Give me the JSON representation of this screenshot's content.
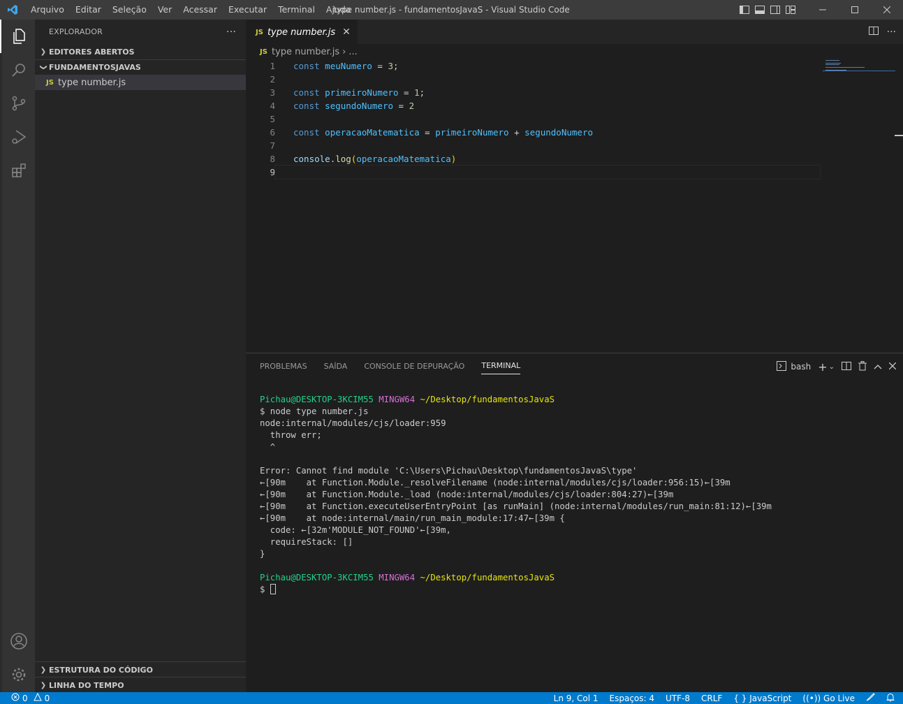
{
  "titlebar": {
    "menu": [
      "Arquivo",
      "Editar",
      "Seleção",
      "Ver",
      "Acessar",
      "Executar",
      "Terminal",
      "Ajuda"
    ],
    "title": "type number.js - fundamentosJavaS - Visual Studio Code"
  },
  "sidebar": {
    "header": "EXPLORADOR",
    "more": "···",
    "open_editors": "EDITORES ABERTOS",
    "folder": "FUNDAMENTOSJAVAS",
    "file_badge": "JS",
    "file": "type number.js",
    "outline": "ESTRUTURA DO CÓDIGO",
    "timeline": "LINHA DO TEMPO"
  },
  "editor": {
    "tab_badge": "JS",
    "tab_label": "type number.js",
    "tab_close": "✕",
    "more": "···",
    "breadcrumb_badge": "JS",
    "breadcrumb_file": "type number.js",
    "breadcrumb_sep": "›",
    "breadcrumb_more": "...",
    "lines": {
      "l1": {
        "n": "1",
        "kw": "const",
        "name": "meuNumero",
        "eq": " = ",
        "val": "3",
        "end": ";"
      },
      "l2": {
        "n": "2"
      },
      "l3": {
        "n": "3",
        "kw": "const",
        "name": "primeiroNumero",
        "eq": " = ",
        "val": "1",
        "end": ";"
      },
      "l4": {
        "n": "4",
        "kw": "const",
        "name": "segundoNumero",
        "eq": " = ",
        "val": "2"
      },
      "l5": {
        "n": "5"
      },
      "l6": {
        "n": "6",
        "kw": "const",
        "name": "operacaoMatematica",
        "eq": " = ",
        "a": "primeiroNumero",
        "plus": " + ",
        "b": "segundoNumero"
      },
      "l7": {
        "n": "7"
      },
      "l8": {
        "n": "8",
        "obj": "console",
        "dot": ".",
        "fn": "log",
        "open": "(",
        "arg": "operacaoMatematica",
        "close": ")"
      },
      "l9": {
        "n": "9"
      }
    }
  },
  "panel": {
    "tabs": [
      "PROBLEMAS",
      "SAÍDA",
      "CONSOLE DE DEPURAÇÃO",
      "TERMINAL"
    ],
    "shell": "bash",
    "terminal": {
      "user": "Pichau@DESKTOP-3KCIM55",
      "env": "MINGW64",
      "path": "~/Desktop/fundamentosJavaS",
      "cmd": "$ node type number.js",
      "out": [
        "node:internal/modules/cjs/loader:959",
        "  throw err;",
        "  ^",
        "",
        "Error: Cannot find module 'C:\\Users\\Pichau\\Desktop\\fundamentosJavaS\\type'",
        "←[90m    at Function.Module._resolveFilename (node:internal/modules/cjs/loader:956:15)←[39m",
        "←[90m    at Function.Module._load (node:internal/modules/cjs/loader:804:27)←[39m",
        "←[90m    at Function.executeUserEntryPoint [as runMain] (node:internal/modules/run_main:81:12)←[39m",
        "←[90m    at node:internal/main/run_main_module:17:47←[39m {",
        "  code: ←[32m'MODULE_NOT_FOUND'←[39m,",
        "  requireStack: []",
        "}"
      ],
      "prompt": "$ "
    }
  },
  "status": {
    "errors": "0",
    "warnings": "0",
    "position": "Ln 9, Col 1",
    "spaces": "Espaços: 4",
    "encoding": "UTF-8",
    "eol": "CRLF",
    "language": "JavaScript",
    "golive": "Go Live"
  }
}
